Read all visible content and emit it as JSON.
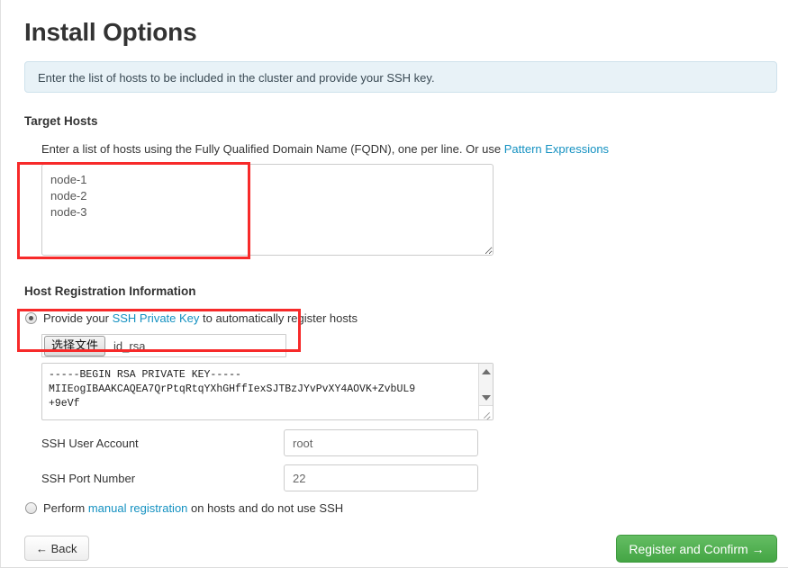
{
  "page": {
    "title": "Install Options",
    "info_message": "Enter the list of hosts to be included in the cluster and provide your SSH key."
  },
  "target_hosts": {
    "heading": "Target Hosts",
    "help_prefix": "Enter a list of hosts using the Fully Qualified Domain Name (FQDN), one per line. Or use ",
    "help_link": "Pattern Expressions",
    "hosts_value": "node-1\nnode-2\nnode-3",
    "hosts_placeholder": ""
  },
  "host_registration": {
    "heading": "Host Registration Information",
    "ssh_option": {
      "selected": true,
      "label_before": "Provide your ",
      "label_link": "SSH Private Key",
      "label_after": " to automatically register hosts"
    },
    "file_input": {
      "button_label": "选择文件",
      "file_name": "id_rsa"
    },
    "ssh_key_value": "-----BEGIN RSA PRIVATE KEY-----\nMIIEogIBAAKCAQEA7QrPtqRtqYXhGHffIexSJTBzJYvPvXY4AOVK+ZvbUL9\n+9eVf",
    "fields": [
      {
        "label": "SSH User Account",
        "value": "root"
      },
      {
        "label": "SSH Port Number",
        "value": "22"
      }
    ],
    "manual_option": {
      "selected": false,
      "label_before": "Perform ",
      "label_link": "manual registration",
      "label_after": " on hosts and do not use SSH"
    }
  },
  "footer": {
    "back_label": "← Back",
    "confirm_label": "Register and Confirm →"
  },
  "colors": {
    "link": "#1491c1",
    "primary_button": "#54b054",
    "info_background": "#e8f2f7",
    "annotation": "#f72a2a"
  }
}
